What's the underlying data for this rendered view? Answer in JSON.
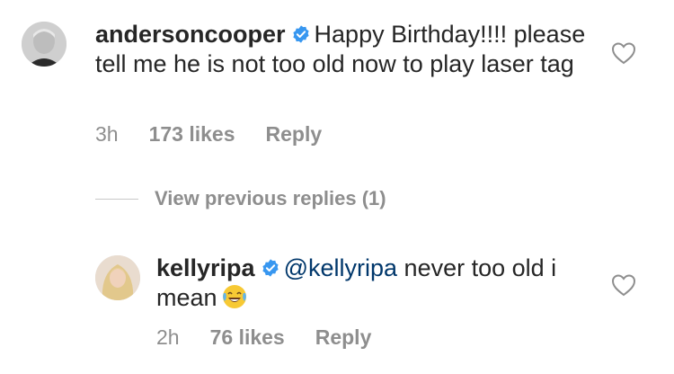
{
  "comments": [
    {
      "username": "andersoncooper",
      "verified": true,
      "text": "Happy Birthday!!!! please tell me he is not too old now to play laser tag",
      "time": "3h",
      "likes": "173 likes",
      "reply_label": "Reply"
    },
    {
      "username": "kellyripa",
      "verified": true,
      "mention": "@kellyripa",
      "text": "never too old i mean",
      "emoji": "face-with-tears-of-joy",
      "time": "2h",
      "likes": "76 likes",
      "reply_label": "Reply"
    }
  ],
  "view_previous_replies": "View previous replies (1)",
  "icons": {
    "verified": "verified-badge-icon",
    "like": "heart-outline-icon"
  },
  "colors": {
    "verified_blue": "#3897f0",
    "mention_blue": "#00376b",
    "meta_gray": "#8e8e8e"
  }
}
